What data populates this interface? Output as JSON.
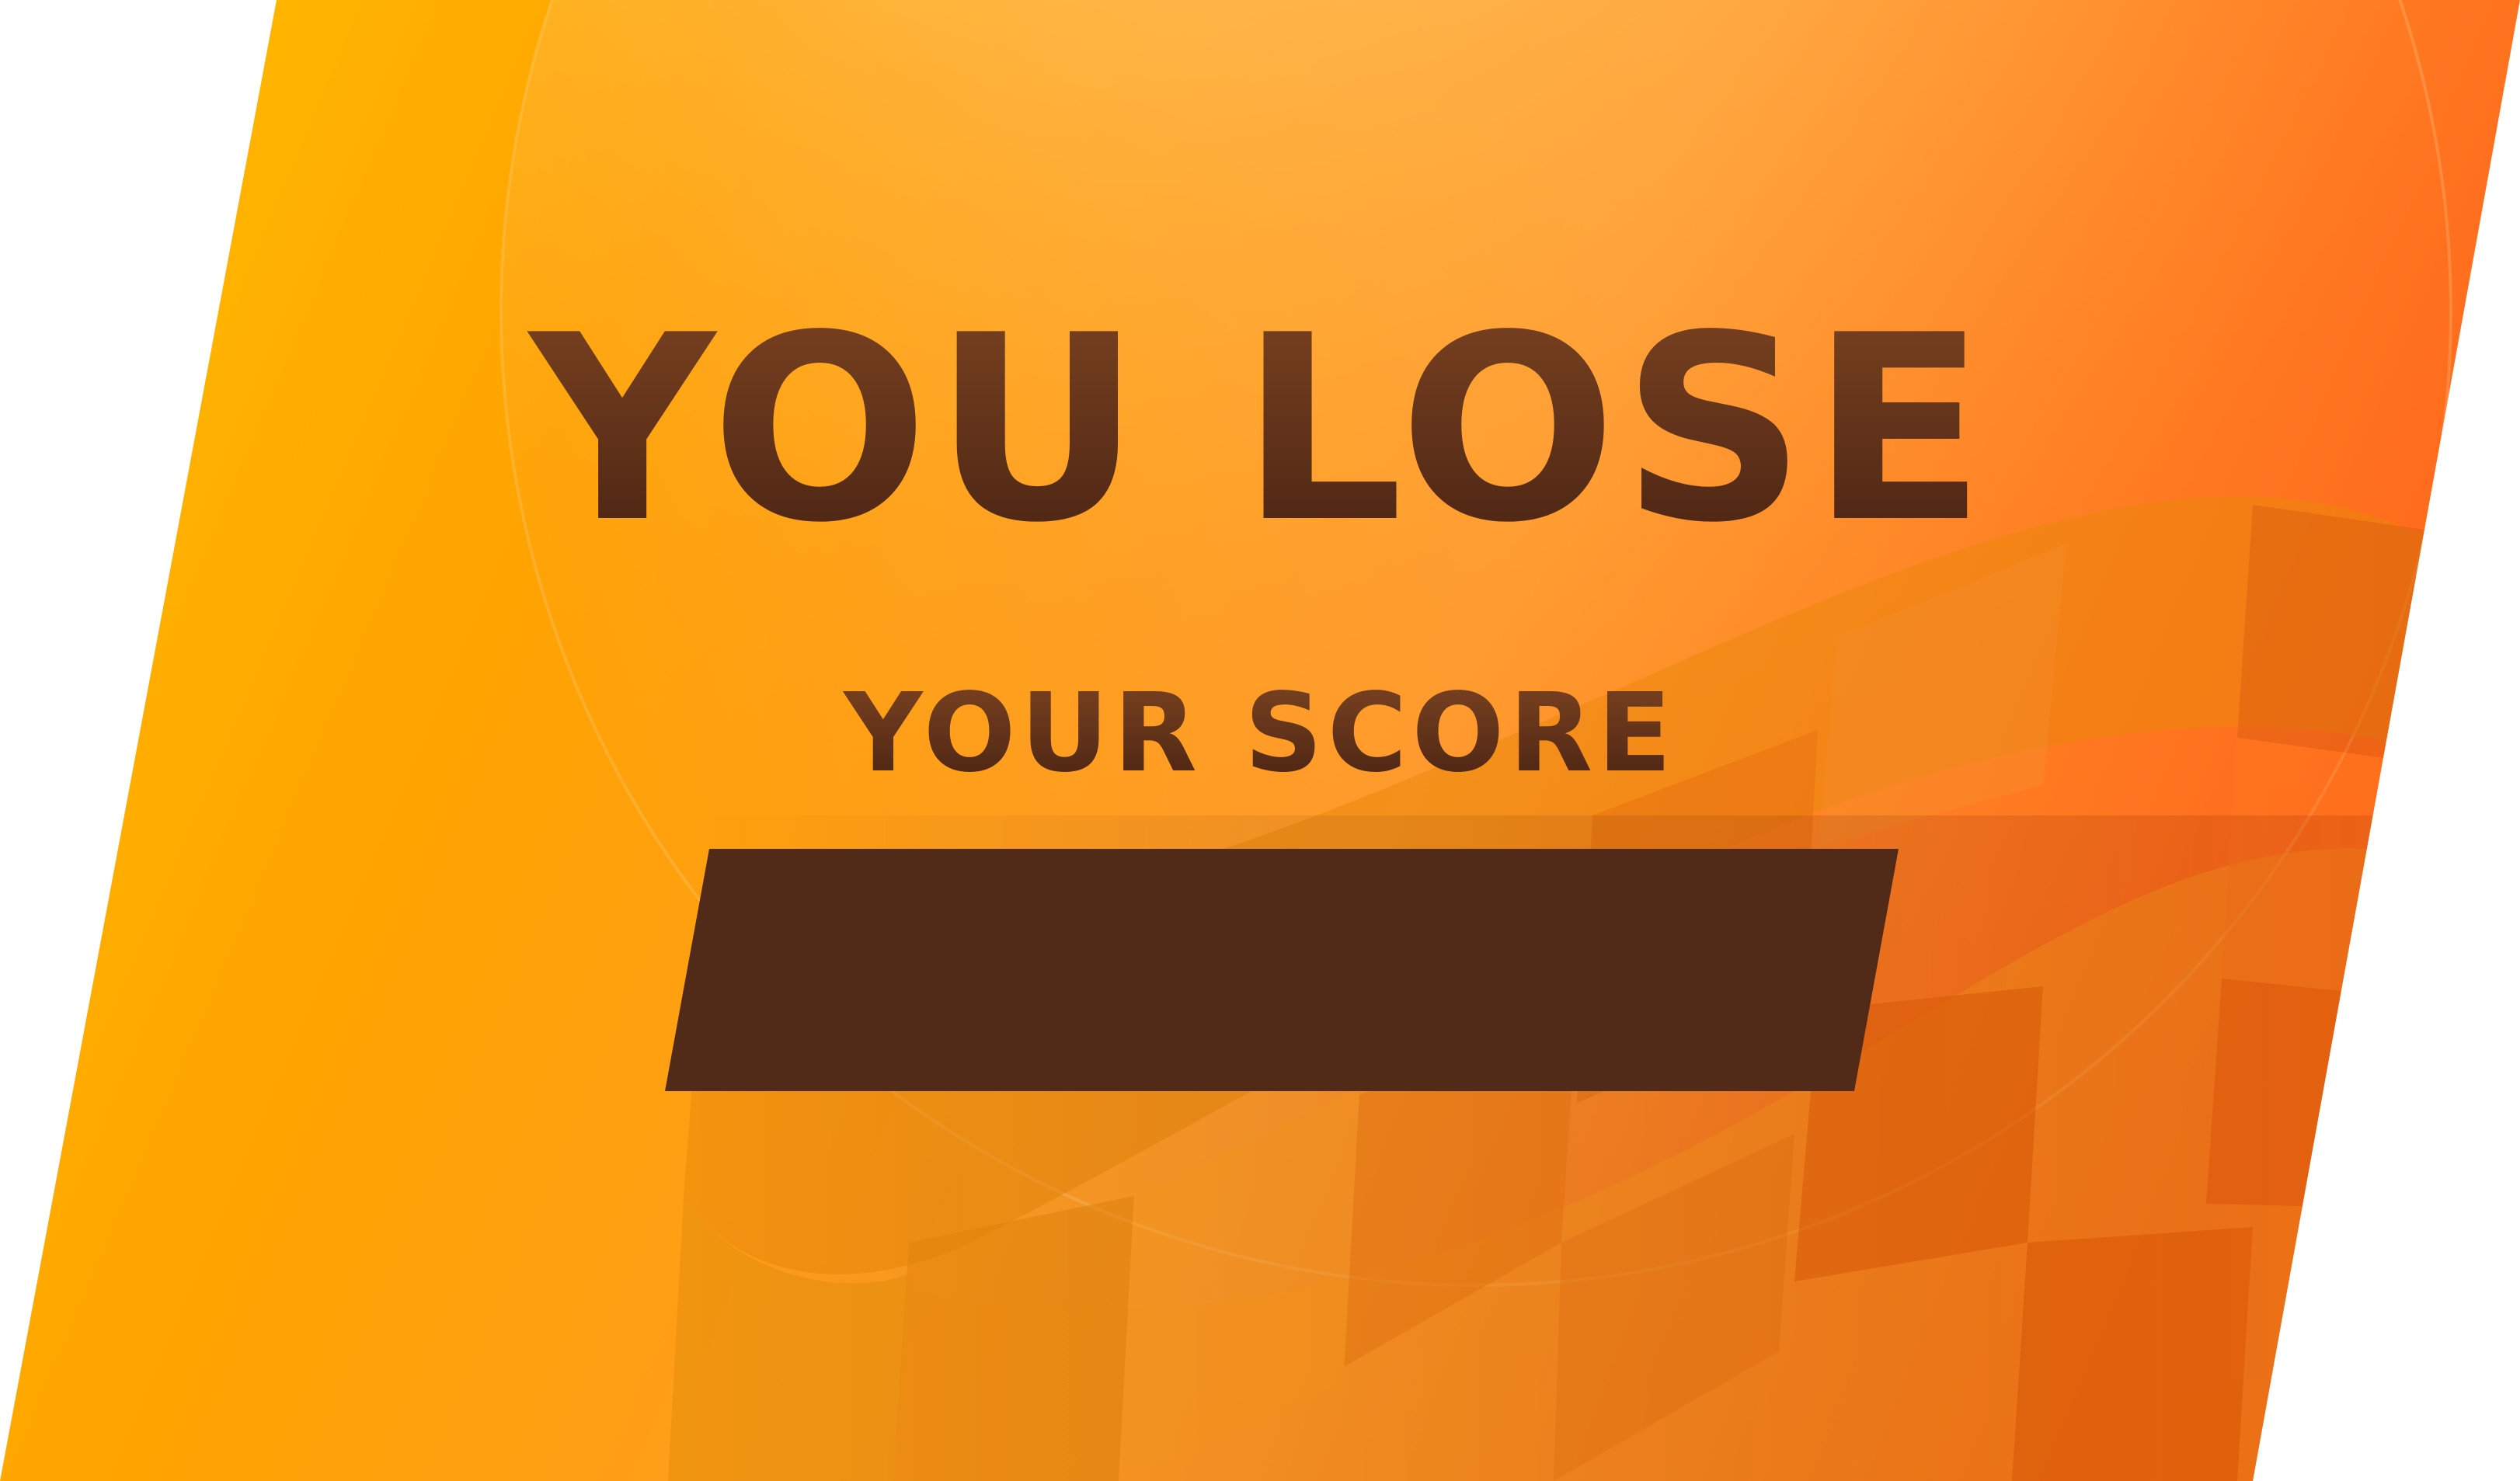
{
  "screen": {
    "name": "game-over",
    "title": "YOU LOSE",
    "score_label": "YOUR SCORE",
    "score_value": ""
  },
  "colors": {
    "panel_left": "#ffc000",
    "panel_mid": "#ffa400",
    "panel_right": "#ff6a1a",
    "text_dark": "#4a2413",
    "text_gradient_top": "#7a4220",
    "score_box": "#512a18",
    "checker_light": "#ffa31e",
    "checker_dark": "#e8870a"
  },
  "icons": {
    "background": "checkered-flag-icon"
  }
}
